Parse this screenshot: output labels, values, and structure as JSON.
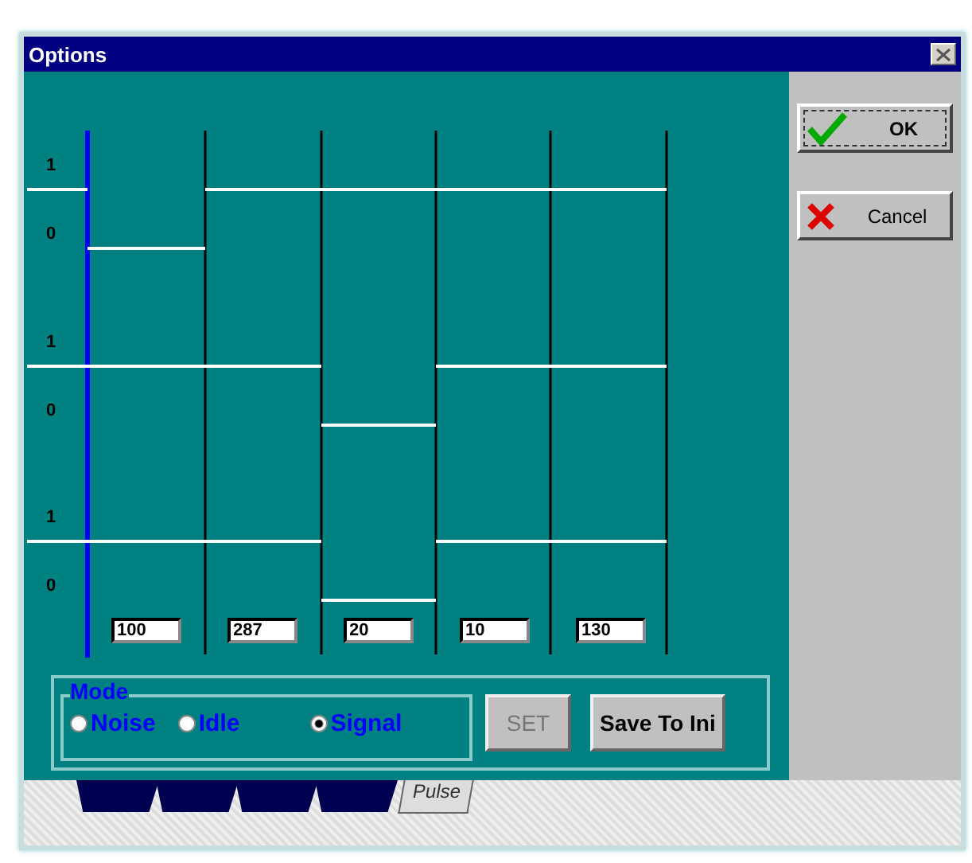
{
  "window": {
    "title": "Options"
  },
  "channels": [
    {
      "high_label": "1",
      "low_label": "0",
      "initial_high": true,
      "segments": [
        {
          "high": false
        },
        {
          "high": true
        },
        {
          "high": true
        },
        {
          "high": true
        },
        {
          "high": true
        }
      ]
    },
    {
      "high_label": "1",
      "low_label": "0",
      "initial_high": true,
      "segments": [
        {
          "high": true
        },
        {
          "high": true
        },
        {
          "high": false
        },
        {
          "high": true
        },
        {
          "high": true
        }
      ]
    },
    {
      "high_label": "1",
      "low_label": "0",
      "initial_high": true,
      "segments": [
        {
          "high": true
        },
        {
          "high": true
        },
        {
          "high": false
        },
        {
          "high": true
        },
        {
          "high": true
        }
      ]
    }
  ],
  "durations": [
    "100",
    "287",
    "20",
    "10",
    "130"
  ],
  "mode": {
    "label": "Mode",
    "options": [
      {
        "label": "Noise",
        "selected": false
      },
      {
        "label": "Idle",
        "selected": false
      },
      {
        "label": "Signal",
        "selected": true
      }
    ]
  },
  "buttons": [
    {
      "label": "SET",
      "disabled": true
    },
    {
      "label": "Save To Ini",
      "disabled": false
    }
  ],
  "side_buttons": [
    {
      "label": "OK",
      "kind": "ok"
    },
    {
      "label": "Cancel",
      "kind": "cancel"
    }
  ],
  "tabs": [
    {
      "selected": false
    },
    {
      "selected": false
    },
    {
      "selected": false
    },
    {
      "selected": false
    },
    {
      "label": "Pulse",
      "selected": true
    }
  ]
}
